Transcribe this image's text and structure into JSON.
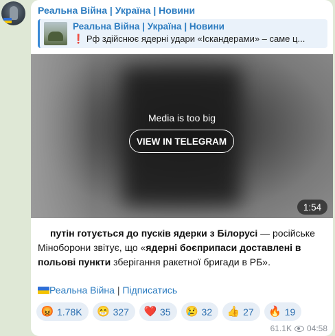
{
  "channel": {
    "name": "Реальна Війна | Україна | Новини"
  },
  "forwarded": {
    "title": "Реальна Війна | Україна | Новини",
    "mark": "❗",
    "text": "Рф здійснює ядерні удари «Іскандерами» – саме ц..."
  },
  "media": {
    "message": "Media is too big",
    "button_label": "VIEW IN TELEGRAM",
    "duration": "1:54"
  },
  "post": {
    "part1": "путін готується до пусків ядерки з Білорусі",
    "part2": " — російське Міноборони звітує, що «",
    "part3": "ядерні боєприпаси доставлені в польові пункти",
    "part4": " зберігання ракетної бригади в РБ»."
  },
  "signature": {
    "channel_link": "Реальна Війна",
    "separator": " | ",
    "subscribe_link": "Підписатись"
  },
  "reactions": [
    {
      "emoji": "😡",
      "icon": "angry-face-icon",
      "count": "1.78K"
    },
    {
      "emoji": "😁",
      "icon": "grinning-face-icon",
      "count": "327"
    },
    {
      "emoji": "❤️",
      "icon": "red-heart-icon",
      "count": "35"
    },
    {
      "emoji": "😢",
      "icon": "crying-face-icon",
      "count": "32"
    },
    {
      "emoji": "👍",
      "icon": "thumbs-up-icon",
      "count": "27"
    },
    {
      "emoji": "🔥",
      "icon": "fire-icon",
      "count": "19"
    }
  ],
  "meta": {
    "views": "61.1K",
    "time": "04:58"
  },
  "colors": {
    "link": "#2c7cc0",
    "background": "#dfe8d6",
    "reaction_bg": "#e7eef6"
  }
}
